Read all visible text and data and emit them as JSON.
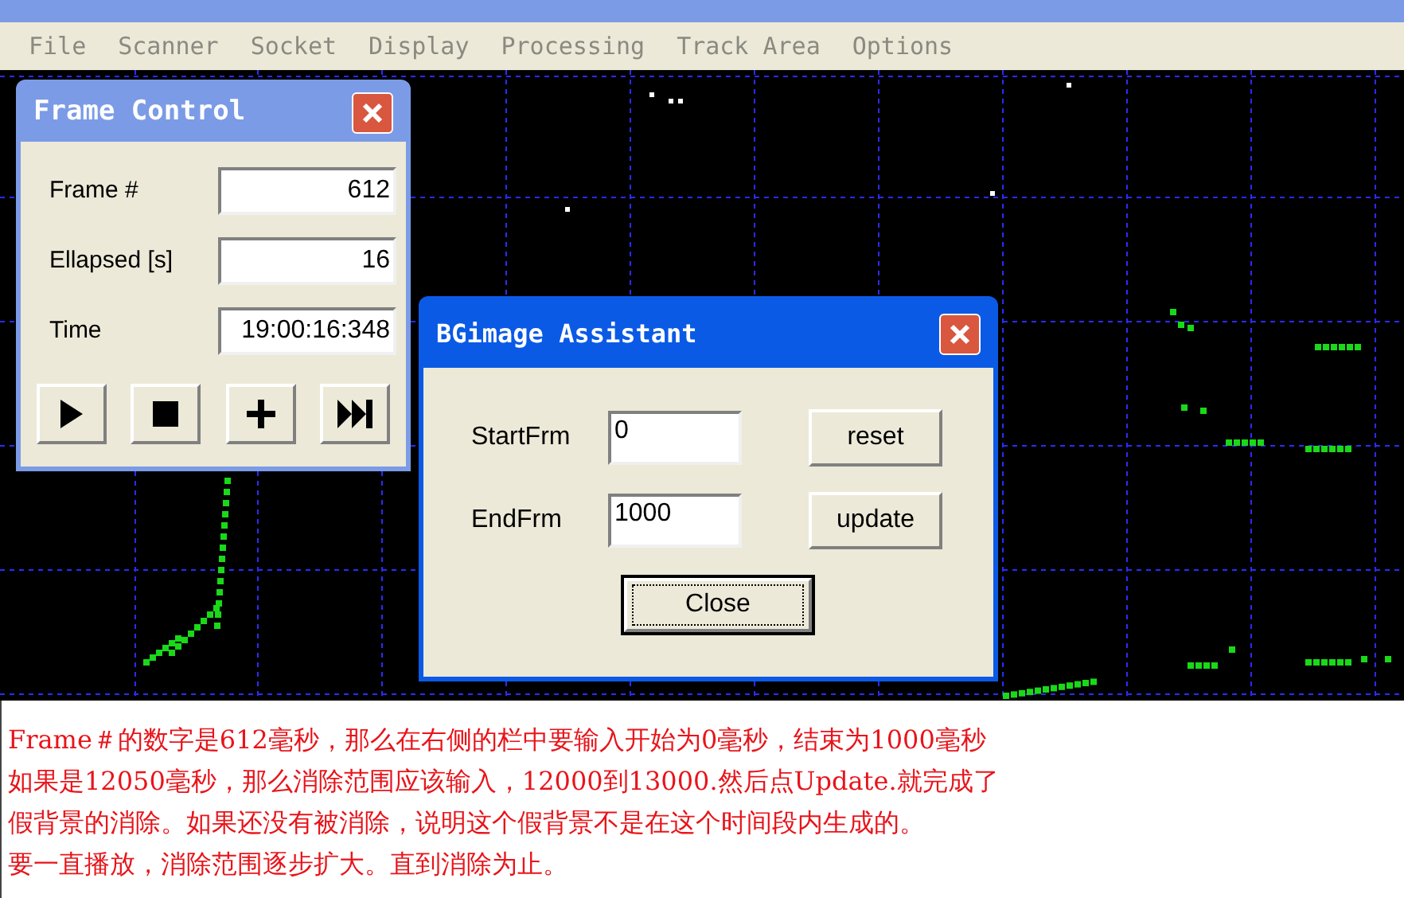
{
  "menu": [
    "File",
    "Scanner",
    "Socket",
    "Display",
    "Processing",
    "Track Area",
    "Options"
  ],
  "frame_control": {
    "title": "Frame Control",
    "fields": [
      {
        "label": "Frame #",
        "value": "612"
      },
      {
        "label": "Ellapsed [s]",
        "value": "16"
      },
      {
        "label": "Time",
        "value": "19:00:16:348"
      }
    ],
    "buttons": [
      {
        "kind": "play"
      },
      {
        "kind": "stop"
      },
      {
        "kind": "add"
      },
      {
        "kind": "skip"
      }
    ]
  },
  "bg_assistant": {
    "title": "BGimage Assistant",
    "fields": [
      {
        "label": "StartFrm",
        "value": "0",
        "button": "reset"
      },
      {
        "label": "EndFrm",
        "value": "1000",
        "button": "update"
      }
    ],
    "close_button": {
      "label": "Close",
      "focused": true
    }
  },
  "note_lines": [
    "Frame＃的数字是612毫秒，那么在右侧的栏中要输入开始为0毫秒，结束为1000毫秒",
    "如果是12050毫秒，那么消除范围应该输入，12000到13000.然后点Update.就完成了",
    "假背景的消除。如果还没有被消除，说明这个假背景不是在这个时间段内生成的。",
    "要一直播放，消除范围逐步扩大。直到消除为止。"
  ]
}
